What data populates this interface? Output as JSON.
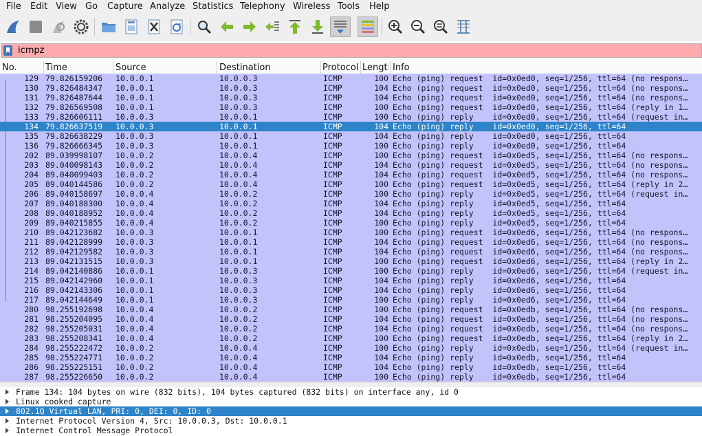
{
  "menu": [
    "File",
    "Edit",
    "View",
    "Go",
    "Capture",
    "Analyze",
    "Statistics",
    "Telephony",
    "Wireless",
    "Tools",
    "Help"
  ],
  "toolbar_icons": [
    "shark-fin-start-icon",
    "stop-square-icon",
    "restart-capture-icon",
    "capture-options-gear-icon",
    "open-folder-icon",
    "save-file-icon",
    "close-file-icon",
    "reload-file-icon",
    "find-packet-icon",
    "go-back-arrow-icon",
    "go-forward-arrow-icon",
    "go-to-packet-icon",
    "first-packet-icon",
    "last-packet-icon",
    "autoscroll-icon",
    "colorize-icon",
    "zoom-in-icon",
    "zoom-out-icon",
    "zoom-reset-icon",
    "resize-columns-icon"
  ],
  "filter": {
    "value": "icmpz"
  },
  "columns": {
    "no": "No.",
    "time": "Time",
    "source": "Source",
    "destination": "Destination",
    "protocol": "Protocol",
    "length": "Length",
    "info": "Info"
  },
  "packets": [
    {
      "no": "129",
      "time": "79.826159206",
      "src": "10.0.0.1",
      "dst": "10.0.0.3",
      "proto": "ICMP",
      "len": "100",
      "info": "Echo (ping) request  id=0x0ed0, seq=1/256, ttl=64 (no respons…"
    },
    {
      "no": "130",
      "time": "79.826484347",
      "src": "10.0.0.1",
      "dst": "10.0.0.3",
      "proto": "ICMP",
      "len": "104",
      "info": "Echo (ping) request  id=0x0ed0, seq=1/256, ttl=64 (no respons…"
    },
    {
      "no": "131",
      "time": "79.826487644",
      "src": "10.0.0.1",
      "dst": "10.0.0.3",
      "proto": "ICMP",
      "len": "104",
      "info": "Echo (ping) request  id=0x0ed0, seq=1/256, ttl=64 (no respons…"
    },
    {
      "no": "132",
      "time": "79.826569508",
      "src": "10.0.0.1",
      "dst": "10.0.0.3",
      "proto": "ICMP",
      "len": "100",
      "info": "Echo (ping) request  id=0x0ed0, seq=1/256, ttl=64 (reply in 1…"
    },
    {
      "no": "133",
      "time": "79.826606111",
      "src": "10.0.0.3",
      "dst": "10.0.0.1",
      "proto": "ICMP",
      "len": "100",
      "info": "Echo (ping) reply    id=0x0ed0, seq=1/256, ttl=64 (request in…"
    },
    {
      "no": "134",
      "time": "79.826637519",
      "src": "10.0.0.3",
      "dst": "10.0.0.1",
      "proto": "ICMP",
      "len": "104",
      "info": "Echo (ping) reply    id=0x0ed0, seq=1/256, ttl=64",
      "selected": true
    },
    {
      "no": "135",
      "time": "79.826638229",
      "src": "10.0.0.3",
      "dst": "10.0.0.1",
      "proto": "ICMP",
      "len": "104",
      "info": "Echo (ping) reply    id=0x0ed0, seq=1/256, ttl=64"
    },
    {
      "no": "136",
      "time": "79.826666345",
      "src": "10.0.0.3",
      "dst": "10.0.0.1",
      "proto": "ICMP",
      "len": "100",
      "info": "Echo (ping) reply    id=0x0ed0, seq=1/256, ttl=64"
    },
    {
      "no": "202",
      "time": "89.039998107",
      "src": "10.0.0.2",
      "dst": "10.0.0.4",
      "proto": "ICMP",
      "len": "100",
      "info": "Echo (ping) request  id=0x0ed5, seq=1/256, ttl=64 (no respons…"
    },
    {
      "no": "203",
      "time": "89.040098143",
      "src": "10.0.0.2",
      "dst": "10.0.0.4",
      "proto": "ICMP",
      "len": "104",
      "info": "Echo (ping) request  id=0x0ed5, seq=1/256, ttl=64 (no respons…"
    },
    {
      "no": "204",
      "time": "89.040099403",
      "src": "10.0.0.2",
      "dst": "10.0.0.4",
      "proto": "ICMP",
      "len": "104",
      "info": "Echo (ping) request  id=0x0ed5, seq=1/256, ttl=64 (no respons…"
    },
    {
      "no": "205",
      "time": "89.040144586",
      "src": "10.0.0.2",
      "dst": "10.0.0.4",
      "proto": "ICMP",
      "len": "100",
      "info": "Echo (ping) request  id=0x0ed5, seq=1/256, ttl=64 (reply in 2…"
    },
    {
      "no": "206",
      "time": "89.040158697",
      "src": "10.0.0.4",
      "dst": "10.0.0.2",
      "proto": "ICMP",
      "len": "100",
      "info": "Echo (ping) reply    id=0x0ed5, seq=1/256, ttl=64 (request in…"
    },
    {
      "no": "207",
      "time": "89.040188300",
      "src": "10.0.0.4",
      "dst": "10.0.0.2",
      "proto": "ICMP",
      "len": "104",
      "info": "Echo (ping) reply    id=0x0ed5, seq=1/256, ttl=64"
    },
    {
      "no": "208",
      "time": "89.040188952",
      "src": "10.0.0.4",
      "dst": "10.0.0.2",
      "proto": "ICMP",
      "len": "104",
      "info": "Echo (ping) reply    id=0x0ed5, seq=1/256, ttl=64"
    },
    {
      "no": "209",
      "time": "89.040215855",
      "src": "10.0.0.4",
      "dst": "10.0.0.2",
      "proto": "ICMP",
      "len": "100",
      "info": "Echo (ping) reply    id=0x0ed5, seq=1/256, ttl=64"
    },
    {
      "no": "210",
      "time": "89.042123682",
      "src": "10.0.0.3",
      "dst": "10.0.0.1",
      "proto": "ICMP",
      "len": "100",
      "info": "Echo (ping) request  id=0x0ed6, seq=1/256, ttl=64 (no respons…"
    },
    {
      "no": "211",
      "time": "89.042128999",
      "src": "10.0.0.3",
      "dst": "10.0.0.1",
      "proto": "ICMP",
      "len": "104",
      "info": "Echo (ping) request  id=0x0ed6, seq=1/256, ttl=64 (no respons…"
    },
    {
      "no": "212",
      "time": "89.042129582",
      "src": "10.0.0.3",
      "dst": "10.0.0.1",
      "proto": "ICMP",
      "len": "104",
      "info": "Echo (ping) request  id=0x0ed6, seq=1/256, ttl=64 (no respons…"
    },
    {
      "no": "213",
      "time": "89.042131515",
      "src": "10.0.0.3",
      "dst": "10.0.0.1",
      "proto": "ICMP",
      "len": "100",
      "info": "Echo (ping) request  id=0x0ed6, seq=1/256, ttl=64 (reply in 2…"
    },
    {
      "no": "214",
      "time": "89.042140886",
      "src": "10.0.0.1",
      "dst": "10.0.0.3",
      "proto": "ICMP",
      "len": "100",
      "info": "Echo (ping) reply    id=0x0ed6, seq=1/256, ttl=64 (request in…"
    },
    {
      "no": "215",
      "time": "89.042142960",
      "src": "10.0.0.1",
      "dst": "10.0.0.3",
      "proto": "ICMP",
      "len": "104",
      "info": "Echo (ping) reply    id=0x0ed6, seq=1/256, ttl=64"
    },
    {
      "no": "216",
      "time": "89.042143306",
      "src": "10.0.0.1",
      "dst": "10.0.0.3",
      "proto": "ICMP",
      "len": "104",
      "info": "Echo (ping) reply    id=0x0ed6, seq=1/256, ttl=64"
    },
    {
      "no": "217",
      "time": "89.042144649",
      "src": "10.0.0.1",
      "dst": "10.0.0.3",
      "proto": "ICMP",
      "len": "100",
      "info": "Echo (ping) reply    id=0x0ed6, seq=1/256, ttl=64"
    },
    {
      "no": "280",
      "time": "98.255192698",
      "src": "10.0.0.4",
      "dst": "10.0.0.2",
      "proto": "ICMP",
      "len": "100",
      "info": "Echo (ping) request  id=0x0edb, seq=1/256, ttl=64 (no respons…"
    },
    {
      "no": "281",
      "time": "98.255204095",
      "src": "10.0.0.4",
      "dst": "10.0.0.2",
      "proto": "ICMP",
      "len": "104",
      "info": "Echo (ping) request  id=0x0edb, seq=1/256, ttl=64 (no respons…"
    },
    {
      "no": "282",
      "time": "98.255205031",
      "src": "10.0.0.4",
      "dst": "10.0.0.2",
      "proto": "ICMP",
      "len": "104",
      "info": "Echo (ping) request  id=0x0edb, seq=1/256, ttl=64 (no respons…"
    },
    {
      "no": "283",
      "time": "98.255208341",
      "src": "10.0.0.4",
      "dst": "10.0.0.2",
      "proto": "ICMP",
      "len": "100",
      "info": "Echo (ping) request  id=0x0edb, seq=1/256, ttl=64 (reply in 2…"
    },
    {
      "no": "284",
      "time": "98.255222472",
      "src": "10.0.0.2",
      "dst": "10.0.0.4",
      "proto": "ICMP",
      "len": "100",
      "info": "Echo (ping) reply    id=0x0edb, seq=1/256, ttl=64 (request in…"
    },
    {
      "no": "285",
      "time": "98.255224771",
      "src": "10.0.0.2",
      "dst": "10.0.0.4",
      "proto": "ICMP",
      "len": "104",
      "info": "Echo (ping) reply    id=0x0edb, seq=1/256, ttl=64"
    },
    {
      "no": "286",
      "time": "98.255225151",
      "src": "10.0.0.2",
      "dst": "10.0.0.4",
      "proto": "ICMP",
      "len": "104",
      "info": "Echo (ping) reply    id=0x0edb, seq=1/256, ttl=64"
    },
    {
      "no": "287",
      "time": "98.255226650",
      "src": "10.0.0.2",
      "dst": "10.0.0.4",
      "proto": "ICMP",
      "len": "100",
      "info": "Echo (ping) reply    id=0x0edb, seq=1/256, ttl=64"
    }
  ],
  "details": [
    {
      "text": "Frame 134: 104 bytes on wire (832 bits), 104 bytes captured (832 bits) on interface any, id 0"
    },
    {
      "text": "Linux cooked capture"
    },
    {
      "text": "802.1Q Virtual LAN, PRI: 0, DEI: 0, ID: 0",
      "selected": true
    },
    {
      "text": "Internet Protocol Version 4, Src: 10.0.0.3, Dst: 10.0.0.1"
    },
    {
      "text": "Internet Control Message Protocol"
    }
  ],
  "colors": {
    "row_bg": "#c3c3fc",
    "selected_bg": "#2d84c8",
    "filter_invalid_bg": "#ffaaad"
  }
}
